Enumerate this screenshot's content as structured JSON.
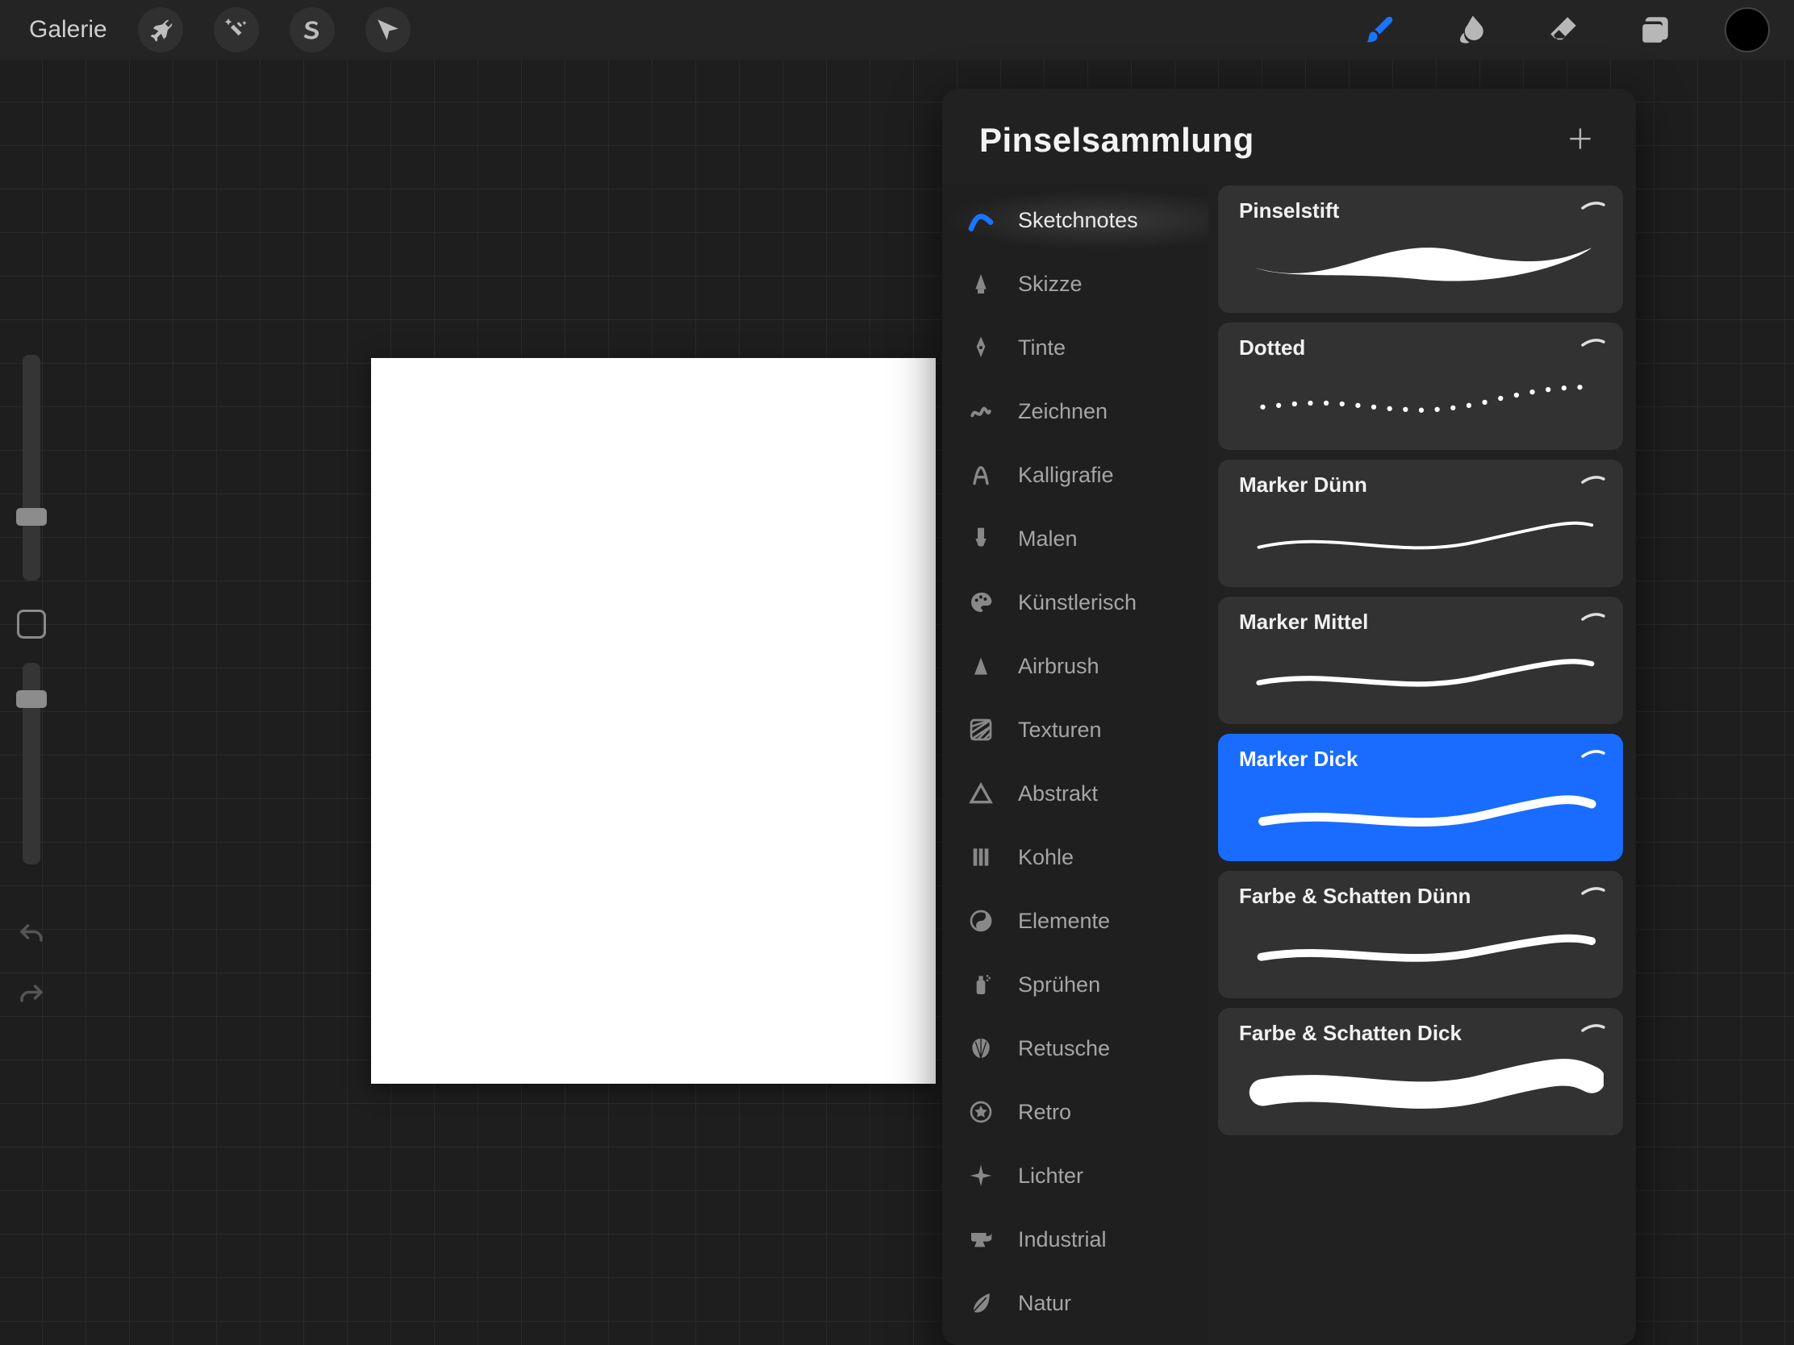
{
  "topbar": {
    "gallery_label": "Galerie"
  },
  "panel": {
    "title": "Pinselsammlung"
  },
  "categories": [
    {
      "id": "sketchnotes",
      "label": "Sketchnotes",
      "icon": "brush-stroke",
      "selected": true
    },
    {
      "id": "skizze",
      "label": "Skizze",
      "icon": "pencil-tip"
    },
    {
      "id": "tinte",
      "label": "Tinte",
      "icon": "fountain-pen"
    },
    {
      "id": "zeichnen",
      "label": "Zeichnen",
      "icon": "scribble"
    },
    {
      "id": "kalligrafie",
      "label": "Kalligrafie",
      "icon": "calligraphy-a"
    },
    {
      "id": "malen",
      "label": "Malen",
      "icon": "paint-brush"
    },
    {
      "id": "kuenstlerisch",
      "label": "Künstlerisch",
      "icon": "palette"
    },
    {
      "id": "airbrush",
      "label": "Airbrush",
      "icon": "spray-cone"
    },
    {
      "id": "texturen",
      "label": "Texturen",
      "icon": "hatch"
    },
    {
      "id": "abstrakt",
      "label": "Abstrakt",
      "icon": "triangle"
    },
    {
      "id": "kohle",
      "label": "Kohle",
      "icon": "bars"
    },
    {
      "id": "elemente",
      "label": "Elemente",
      "icon": "yin-yang"
    },
    {
      "id": "spruehen",
      "label": "Sprühen",
      "icon": "spray-can"
    },
    {
      "id": "retusche",
      "label": "Retusche",
      "icon": "shell"
    },
    {
      "id": "retro",
      "label": "Retro",
      "icon": "star-circle"
    },
    {
      "id": "lichter",
      "label": "Lichter",
      "icon": "sparkle"
    },
    {
      "id": "industrial",
      "label": "Industrial",
      "icon": "anvil"
    },
    {
      "id": "natur",
      "label": "Natur",
      "icon": "leaf"
    }
  ],
  "brushes": [
    {
      "id": "pinselstift",
      "label": "Pinselstift",
      "preview": "thick-swell",
      "selected": false
    },
    {
      "id": "dotted",
      "label": "Dotted",
      "preview": "dotted",
      "selected": false
    },
    {
      "id": "marker-duenn",
      "label": "Marker Dünn",
      "preview": "thin-line",
      "selected": false
    },
    {
      "id": "marker-mittel",
      "label": "Marker Mittel",
      "preview": "medium-line",
      "selected": false
    },
    {
      "id": "marker-dick",
      "label": "Marker Dick",
      "preview": "thick-line",
      "selected": true
    },
    {
      "id": "farbe-schatten-duenn",
      "label": "Farbe & Schatten Dünn",
      "preview": "shade-thin",
      "selected": false
    },
    {
      "id": "farbe-schatten-dick",
      "label": "Farbe & Schatten Dick",
      "preview": "shade-thick",
      "selected": false
    }
  ],
  "sliders": {
    "brush_size_thumb_pct": 68,
    "opacity_thumb_pct": 13
  },
  "colors": {
    "accent": "#196cff",
    "current_color": "#000000"
  }
}
